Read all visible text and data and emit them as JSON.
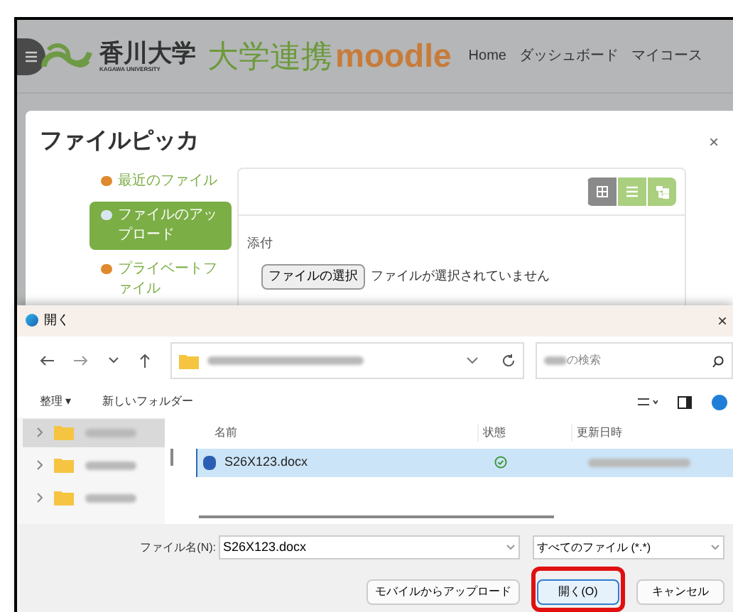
{
  "header": {
    "logo_title": "香川大学",
    "logo_subtitle": "KAGAWA UNIVERSITY",
    "brand": "大学連携",
    "brand_moodle": "moodle",
    "nav_links": [
      "Home",
      "ダッシュボード",
      "マイコース"
    ]
  },
  "file_picker": {
    "title": "ファイルピッカ",
    "close": "×",
    "repositories": [
      {
        "label": "最近のファイル",
        "selected": false
      },
      {
        "label": "ファイルのアップロード",
        "selected": true
      },
      {
        "label": "プライベートファイル",
        "selected": false
      }
    ],
    "view_buttons": [
      {
        "kind": "icons",
        "selected": true
      },
      {
        "kind": "list",
        "selected": false
      },
      {
        "kind": "tree",
        "selected": false
      }
    ],
    "attachment_label": "添付",
    "choose_button": "ファイルの選択",
    "no_file_text": "ファイルが選択されていません"
  },
  "open_dialog": {
    "title": "開く",
    "close": "×",
    "search_placeholder": "の検索",
    "commands": [
      {
        "label": "整理 ▾"
      },
      {
        "label": "新しいフォルダー"
      }
    ],
    "tree_items": [
      {
        "selected": true
      },
      {
        "selected": false
      },
      {
        "selected": false
      }
    ],
    "columns": [
      "名前",
      "状態",
      "更新日時"
    ],
    "files": [
      {
        "name": "S26X123.docx",
        "selected": true,
        "synced": true
      }
    ],
    "file_name_label": "ファイル名(N):",
    "file_name_value": "S26X123.docx",
    "filter": "すべてのファイル (*.*)",
    "buttons": [
      {
        "label": "モバイルからアップロード",
        "highlighted": false
      },
      {
        "label": "開く(O)",
        "highlighted": true
      },
      {
        "label": "キャンセル",
        "highlighted": false
      }
    ]
  }
}
